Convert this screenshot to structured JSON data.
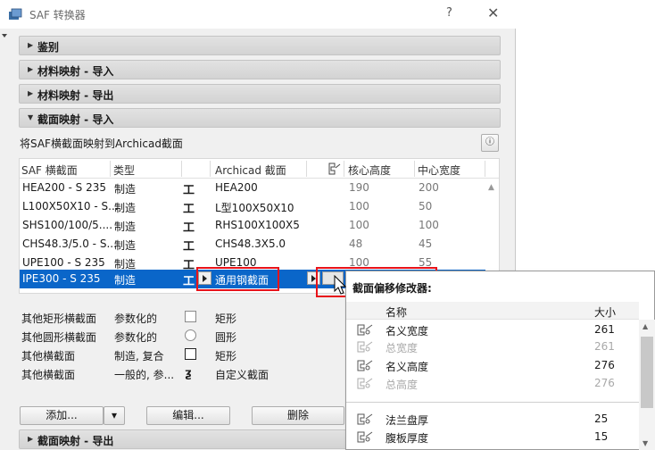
{
  "window": {
    "title": "SAF 转换器",
    "help": "?",
    "close": "✕"
  },
  "sections": {
    "s1": "鉴别",
    "s2": "材料映射 - 导入",
    "s3": "材料映射 - 导出",
    "s4": "截面映射 - 导入",
    "s5": "截面映射 - 导出"
  },
  "description": "将SAF横截面映射到Archicad截面",
  "info_icon": "ⓘ",
  "table": {
    "headers": {
      "saf": "SAF 横截面",
      "type": "类型",
      "archicad": "Archicad 截面",
      "core_h": "核心高度",
      "center_w": "中心宽度"
    },
    "rows": [
      {
        "saf": "HEA200 - S 235",
        "type": "制造",
        "archicad": "HEA200",
        "h": "190",
        "w": "200"
      },
      {
        "saf": "L100X50X10 - S...",
        "type": "制造",
        "archicad": "L型100X50X10",
        "h": "100",
        "w": "50"
      },
      {
        "saf": "SHS100/100/5....",
        "type": "制造",
        "archicad": "RHS100X100X5",
        "h": "100",
        "w": "100"
      },
      {
        "saf": "CHS48.3/5.0 - S...",
        "type": "制造",
        "archicad": "CHS48.3X5.0",
        "h": "48",
        "w": "45"
      },
      {
        "saf": "UPE100 - S 235",
        "type": "制造",
        "archicad": "UPE100",
        "h": "100",
        "w": "55"
      },
      {
        "saf": "IPE300 - S 235",
        "type": "制造",
        "archicad": "通用钢截面",
        "h": "",
        "w": ""
      }
    ]
  },
  "others": [
    {
      "name": "其他矩形横截面",
      "type": "参数化的",
      "archicad": "矩形"
    },
    {
      "name": "其他圆形横截面",
      "type": "参数化的",
      "archicad": "圆形"
    },
    {
      "name": "其他横截面",
      "type": "制造, 复合",
      "archicad": "矩形"
    },
    {
      "name": "其他横截面",
      "type": "一般的, 参...",
      "archicad": "自定义截面"
    }
  ],
  "buttons": {
    "add": "添加...",
    "edit": "编辑...",
    "delete": "删除"
  },
  "popup": {
    "title": "截面偏移修改器:",
    "headers": {
      "name": "名称",
      "size": "大小"
    },
    "rows": [
      {
        "name": "名义宽度",
        "value": "261",
        "dim": false
      },
      {
        "name": "总宽度",
        "value": "261",
        "dim": true
      },
      {
        "name": "名义高度",
        "value": "276",
        "dim": false
      },
      {
        "name": "总高度",
        "value": "276",
        "dim": true
      },
      {
        "name": "法兰盘厚",
        "value": "25",
        "dim": false
      },
      {
        "name": "腹板厚度",
        "value": "15",
        "dim": false
      }
    ]
  },
  "colors": {
    "selection": "#0a66c9",
    "highlight": "#e8131a"
  }
}
